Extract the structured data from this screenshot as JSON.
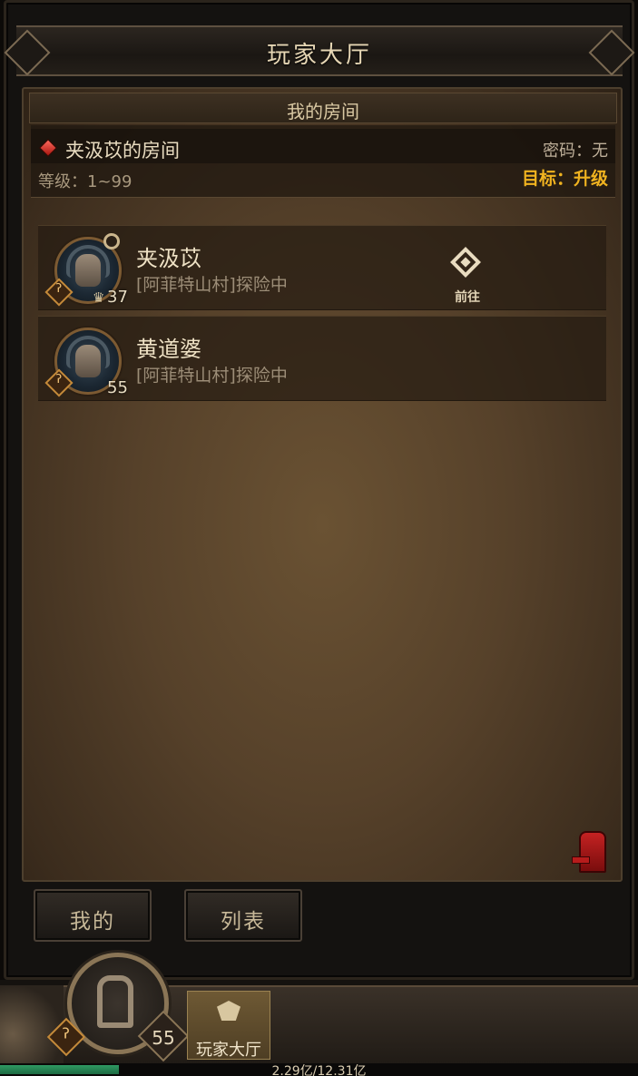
{
  "header": {
    "title": "玩家大厅"
  },
  "panel": {
    "title": "我的房间"
  },
  "room": {
    "name": "夹汲苡的房间",
    "password": "密码：无",
    "level_range": "等级：1~99",
    "target": "目标：升级"
  },
  "members": [
    {
      "name": "夹汲苡",
      "status": "[阿菲特山村]探险中",
      "level": "37",
      "crown": "♛",
      "action_label": "前往"
    },
    {
      "name": "黄道婆",
      "status": "[阿菲特山村]探险中",
      "level": "55"
    }
  ],
  "tabs": {
    "mine": "我的",
    "list": "列表"
  },
  "hud": {
    "level": "55",
    "lobby_label": "玩家大厅",
    "exp_text": "2.29亿/12.31亿",
    "exp_fraction": 0.186
  },
  "icons": {
    "class_badge": "key-icon",
    "glyph": "ʔ"
  },
  "colors": {
    "gem": "#d4251a",
    "target_text": "#f0b320",
    "exit": "#c42222",
    "exp": "#2f9a62"
  }
}
